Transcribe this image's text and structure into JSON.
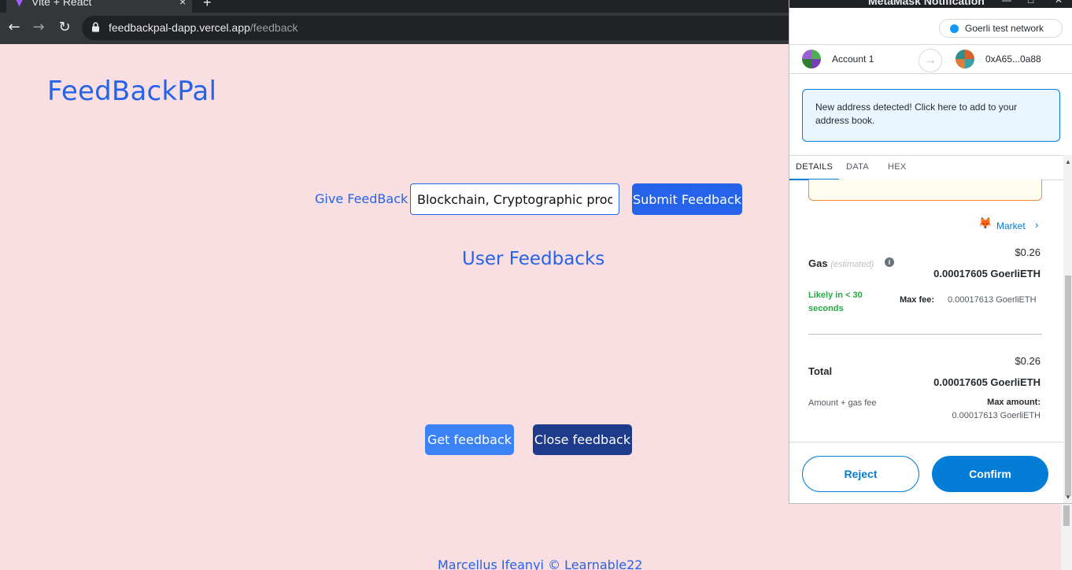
{
  "browser": {
    "tab_title": "Vite + React",
    "tab_close": "×",
    "new_tab": "+",
    "url_host": "feedbackpal-dapp.vercel.app",
    "url_path": "/feedback"
  },
  "page": {
    "brand": "FeedBackPal",
    "give_label": "Give FeedBack",
    "input_value": "Blockchain, Cryptographic proof of",
    "submit_label": "Submit Feedback",
    "section_title": "User Feedbacks",
    "get_label": "Get feedback",
    "close_label": "Close feedback",
    "footer": "Marcellus Ifeanyi © Learnable22"
  },
  "metamask": {
    "window_title": "MetaMask Notification",
    "network": "Goerli test network",
    "from_account": "Account 1",
    "to_address": "0xA65...0a88",
    "alert": "New address detected! Click here to add to your address book.",
    "tabs": [
      "DETAILS",
      "DATA",
      "HEX"
    ],
    "market": "Market",
    "gas_label": "Gas",
    "gas_estimated": "(estimated)",
    "gas_usd": "$0.26",
    "gas_eth": "0.00017605 GoerliETH",
    "likely": "Likely in < 30 seconds",
    "max_fee_label": "Max fee:",
    "max_fee_value": "0.00017613 GoerliETH",
    "total_label": "Total",
    "total_usd": "$0.26",
    "total_eth": "0.00017605 GoerliETH",
    "amount_gas": "Amount + gas fee",
    "max_amount_label": "Max amount:",
    "max_amount_value": "0.00017613 GoerliETH",
    "reject": "Reject",
    "confirm": "Confirm"
  },
  "colors": {
    "page_bg": "#f9dfe1",
    "brand_blue": "#2563eb",
    "close_btn": "#1e3a8a",
    "metamask_blue": "#037dd6",
    "success_green": "#28a745"
  }
}
